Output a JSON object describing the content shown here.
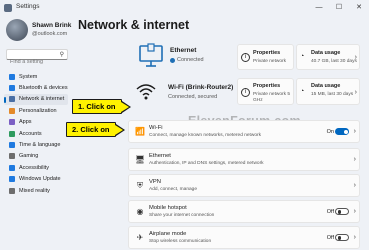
{
  "window": {
    "title": "Settings",
    "minimize": "—",
    "maximize": "☐",
    "close": "✕"
  },
  "user": {
    "name": "Shawn Brink",
    "email": "@outlook.com"
  },
  "search": {
    "placeholder": "Find a setting"
  },
  "nav": [
    {
      "label": "System",
      "color": "#1f7ae0"
    },
    {
      "label": "Bluetooth & devices",
      "color": "#1f7ae0"
    },
    {
      "label": "Network & internet",
      "color": "#4a6fa5"
    },
    {
      "label": "Personalization",
      "color": "#e38a2b"
    },
    {
      "label": "Apps",
      "color": "#7b5fc4"
    },
    {
      "label": "Accounts",
      "color": "#2e9b5f"
    },
    {
      "label": "Time & language",
      "color": "#1f7ae0"
    },
    {
      "label": "Gaming",
      "color": "#6d6d6d"
    },
    {
      "label": "Accessibility",
      "color": "#1f7ae0"
    },
    {
      "label": "Windows Update",
      "color": "#1f7ae0"
    },
    {
      "label": "Mixed reality",
      "color": "#6d6d6d"
    }
  ],
  "page_title": "Network & internet",
  "hero": {
    "ethernet": {
      "name": "Ethernet",
      "status": "Connected",
      "properties_title": "Properties",
      "properties_sub": "Private network",
      "usage_title": "Data usage",
      "usage_sub": "40.7 GB, last 30 days"
    },
    "wifi": {
      "name": "Wi-Fi (Brink-Router2)",
      "status": "Connected, secured",
      "properties_title": "Properties",
      "properties_sub": "Private network 5 GHz",
      "usage_title": "Data usage",
      "usage_sub": "15 MB, last 30 days"
    }
  },
  "settings": [
    {
      "title": "Wi-Fi",
      "sub": "Connect, manage known networks, metered network",
      "state": "On",
      "toggle": "on",
      "icon": "wifi-icon"
    },
    {
      "title": "Ethernet",
      "sub": "Authentication, IP and DNS settings, metered network",
      "state": "",
      "toggle": "",
      "icon": "ethernet-icon"
    },
    {
      "title": "VPN",
      "sub": "Add, connect, manage",
      "state": "",
      "toggle": "",
      "icon": "vpn-icon"
    },
    {
      "title": "Mobile hotspot",
      "sub": "Share your internet connection",
      "state": "Off",
      "toggle": "off",
      "icon": "hotspot-icon"
    },
    {
      "title": "Airplane mode",
      "sub": "Stop wireless communication",
      "state": "Off",
      "toggle": "off",
      "icon": "airplane-icon"
    }
  ],
  "callouts": {
    "one": "1. Click on",
    "two": "2. Click on"
  },
  "watermark": "ElevenForum.com"
}
